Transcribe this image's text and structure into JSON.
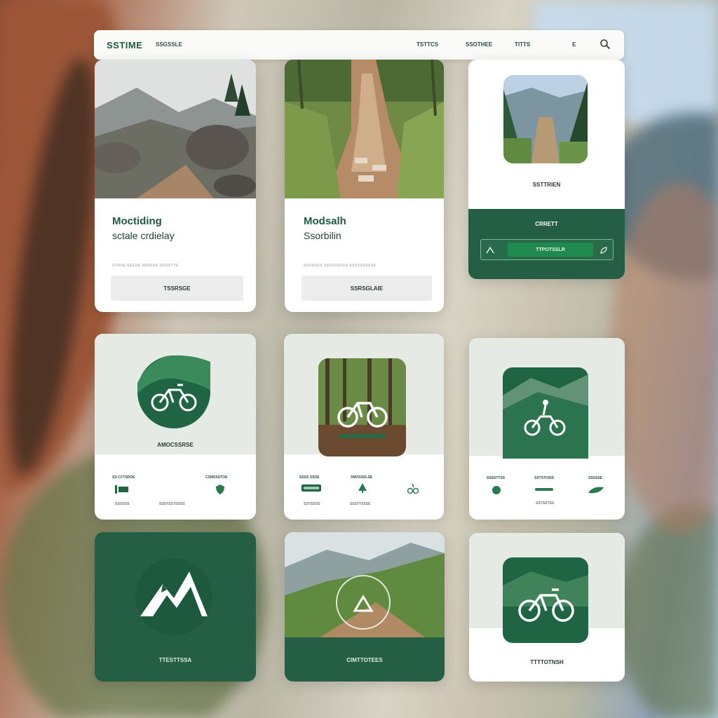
{
  "colors": {
    "brand_green": "#245f45",
    "accent_green": "#1f8a4d",
    "panel_bg": "#ffffff",
    "pale_bg": "#e5ebe4"
  },
  "nav": {
    "logo": "SSTIME",
    "link1": "SSGSSLE",
    "link2": "TSTTCS",
    "link3": "SSOTHEE",
    "link4": "TITTS",
    "link5": "E",
    "search_icon": "search-icon"
  },
  "card1": {
    "title": "Moctiding",
    "subtitle": "sctale crdielay",
    "micro": "STRSE SEEDE SERSSE SOOSTTE",
    "button": "TSSRSGE"
  },
  "card2": {
    "title": "Modsalh",
    "subtitle": "Ssorbilin",
    "micro": "SSSSSSS SSSSSSSSS SSSSSSSSSE",
    "button": "SSRSGLAIE"
  },
  "card3": {
    "label": "SSTTRIEN",
    "band_label": "CRRETT",
    "input_value": "TTPOTSSLR",
    "left_icon": "caret-up-icon",
    "right_icon": "leaf-icon"
  },
  "card4": {
    "label": "AMOCSSRSE",
    "stat1": "SS CCTSDOE",
    "stat2": "CSMSSSTOE",
    "stat3": "SSOSSS",
    "stat4": "SSSTSSTSSOS"
  },
  "card5": {
    "stat1": "SSSS  SSOE",
    "stat2": "SMOSSSLSE",
    "stat3": "SSTSSOS",
    "stat4": "SSSTTSSSE"
  },
  "card6": {
    "stat1": "SSSSTTSS",
    "stat2": "SSTSTOSIS",
    "stat3": "SSSSSE",
    "stat4": "SSTSSTSS"
  },
  "card7": {
    "label": "TTESTTSSA"
  },
  "card8": {
    "label": "CIMTTOTEES"
  },
  "card9": {
    "label": "TTTTOTNSH"
  }
}
